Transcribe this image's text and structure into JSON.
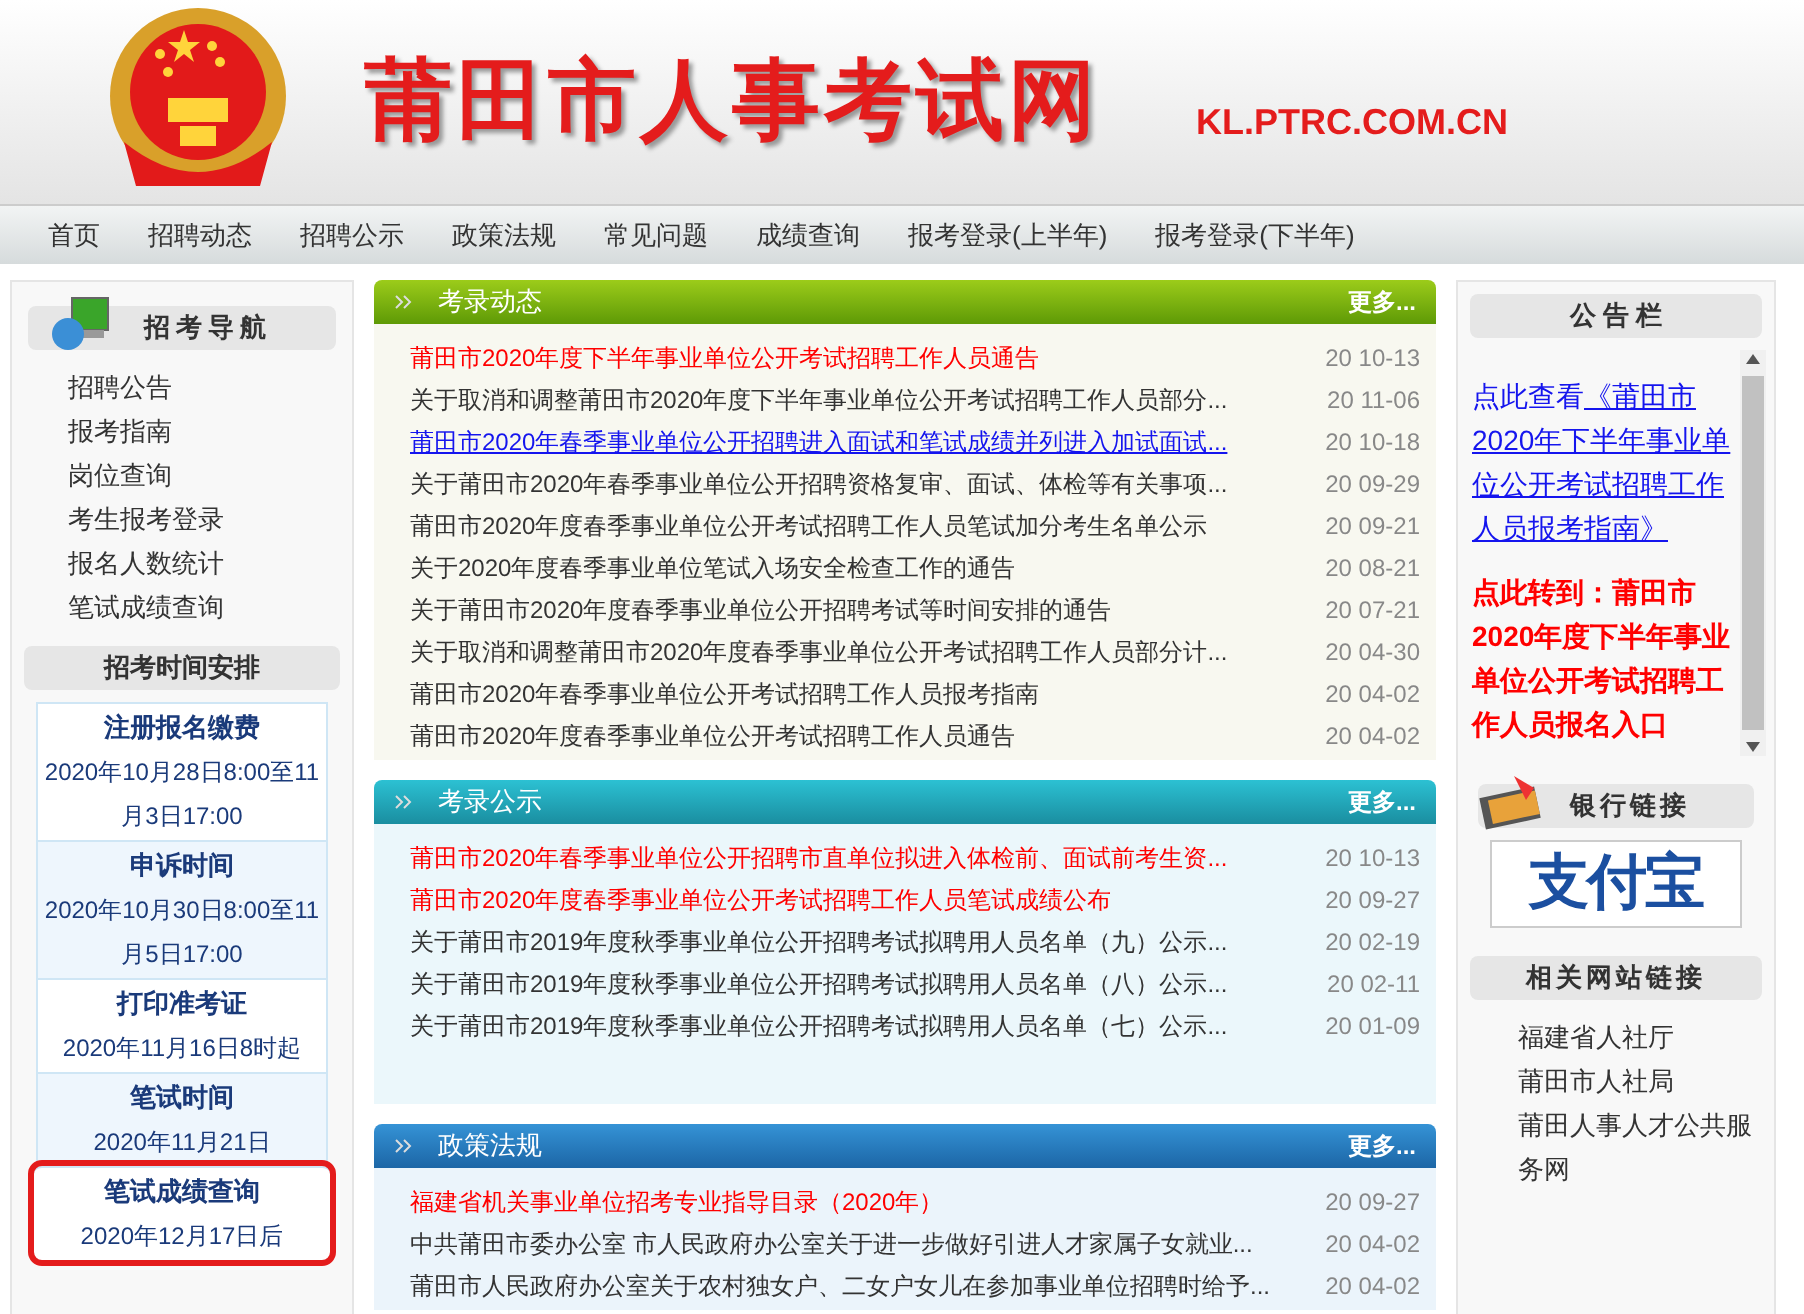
{
  "header": {
    "site_title": "莆田市人事考试网",
    "domain": "KL.PTRC.COM.CN"
  },
  "nav": [
    "首页",
    "招聘动态",
    "招聘公示",
    "政策法规",
    "常见问题",
    "成绩查询",
    "报考登录(上半年)",
    "报考登录(下半年)"
  ],
  "sidebar": {
    "nav_title": "招考导航",
    "links": [
      "招聘公告",
      "报考指南",
      "岗位查询",
      "考生报考登录",
      "报名人数统计",
      "笔试成绩查询"
    ],
    "schedule_title": "招考时间安排",
    "schedule": [
      {
        "title": "注册报名缴费",
        "time": "2020年10月28日8:00至11月3日17:00",
        "highlighted": false
      },
      {
        "title": "申诉时间",
        "time": "2020年10月30日8:00至11月5日17:00",
        "highlighted": false
      },
      {
        "title": "打印准考证",
        "time": "2020年11月16日8时起",
        "highlighted": false
      },
      {
        "title": "笔试时间",
        "time": "2020年11月21日",
        "highlighted": false
      },
      {
        "title": "笔试成绩查询",
        "time": "2020年12月17日后",
        "highlighted": true
      }
    ]
  },
  "panels": [
    {
      "kind": "green",
      "title": "考录动态",
      "more": "更多...",
      "items": [
        {
          "kind": "highlight",
          "text": "莆田市2020年度下半年事业单位公开考试招聘工作人员通告",
          "date": "20 10-13"
        },
        {
          "kind": "normal",
          "text": "关于取消和调整莆田市2020年度下半年事业单位公开考试招聘工作人员部分...",
          "date": "20 11-06"
        },
        {
          "kind": "link",
          "text": "莆田市2020年春季事业单位公开招聘进入面试和笔试成绩并列进入加试面试...",
          "date": "20 10-18"
        },
        {
          "kind": "normal",
          "text": "关于莆田市2020年春季事业单位公开招聘资格复审、面试、体检等有关事项...",
          "date": "20 09-29"
        },
        {
          "kind": "normal",
          "text": "莆田市2020年度春季事业单位公开考试招聘工作人员笔试加分考生名单公示",
          "date": "20 09-21"
        },
        {
          "kind": "normal",
          "text": "关于2020年度春季事业单位笔试入场安全检查工作的通告",
          "date": "20 08-21"
        },
        {
          "kind": "normal",
          "text": "关于莆田市2020年度春季事业单位公开招聘考试等时间安排的通告",
          "date": "20 07-21"
        },
        {
          "kind": "normal",
          "text": "关于取消和调整莆田市2020年度春季事业单位公开考试招聘工作人员部分计...",
          "date": "20 04-30"
        },
        {
          "kind": "normal",
          "text": "莆田市2020年春季事业单位公开考试招聘工作人员报考指南",
          "date": "20 04-02"
        },
        {
          "kind": "normal",
          "text": "莆田市2020年度春季事业单位公开考试招聘工作人员通告",
          "date": "20 04-02"
        }
      ]
    },
    {
      "kind": "teal",
      "title": "考录公示",
      "more": "更多...",
      "items": [
        {
          "kind": "highlight",
          "text": "莆田市2020年春季事业单位公开招聘市直单位拟进入体检前、面试前考生资...",
          "date": "20 10-13"
        },
        {
          "kind": "highlight",
          "text": "莆田市2020年度春季事业单位公开考试招聘工作人员笔试成绩公布",
          "date": "20 09-27"
        },
        {
          "kind": "normal",
          "text": "关于莆田市2019年度秋季事业单位公开招聘考试拟聘用人员名单（九）公示...",
          "date": "20 02-19"
        },
        {
          "kind": "normal",
          "text": "关于莆田市2019年度秋季事业单位公开招聘考试拟聘用人员名单（八）公示...",
          "date": "20 02-11"
        },
        {
          "kind": "normal",
          "text": "关于莆田市2019年度秋季事业单位公开招聘考试拟聘用人员名单（七）公示...",
          "date": "20 01-09"
        }
      ]
    },
    {
      "kind": "blue",
      "title": "政策法规",
      "more": "更多...",
      "items": [
        {
          "kind": "highlight",
          "text": "福建省机关事业单位招考专业指导目录（2020年）",
          "date": "20 09-27"
        },
        {
          "kind": "normal",
          "text": "中共莆田市委办公室 市人民政府办公室关于进一步做好引进人才家属子女就业...",
          "date": "20 04-02"
        },
        {
          "kind": "normal",
          "text": "莆田市人民政府办公室关于农村独女户、二女户女儿在参加事业单位招聘时给予...",
          "date": "20 04-02"
        }
      ]
    }
  ],
  "notice": {
    "title": "公 告 栏",
    "link_prefix": "点此查看",
    "link_text": "《莆田市2020年下半年事业单位公开考试招聘工作人员报考指南》",
    "alert": "点此转到：莆田市2020年度下半年事业单位公开考试招聘工作人员报名入口"
  },
  "bank": {
    "title": "银行链接",
    "logo": "支付宝"
  },
  "related": {
    "title": "相关网站链接",
    "links": [
      "福建省人社厅",
      "莆田市人社局",
      "莆田人事人才公共服务网"
    ]
  }
}
